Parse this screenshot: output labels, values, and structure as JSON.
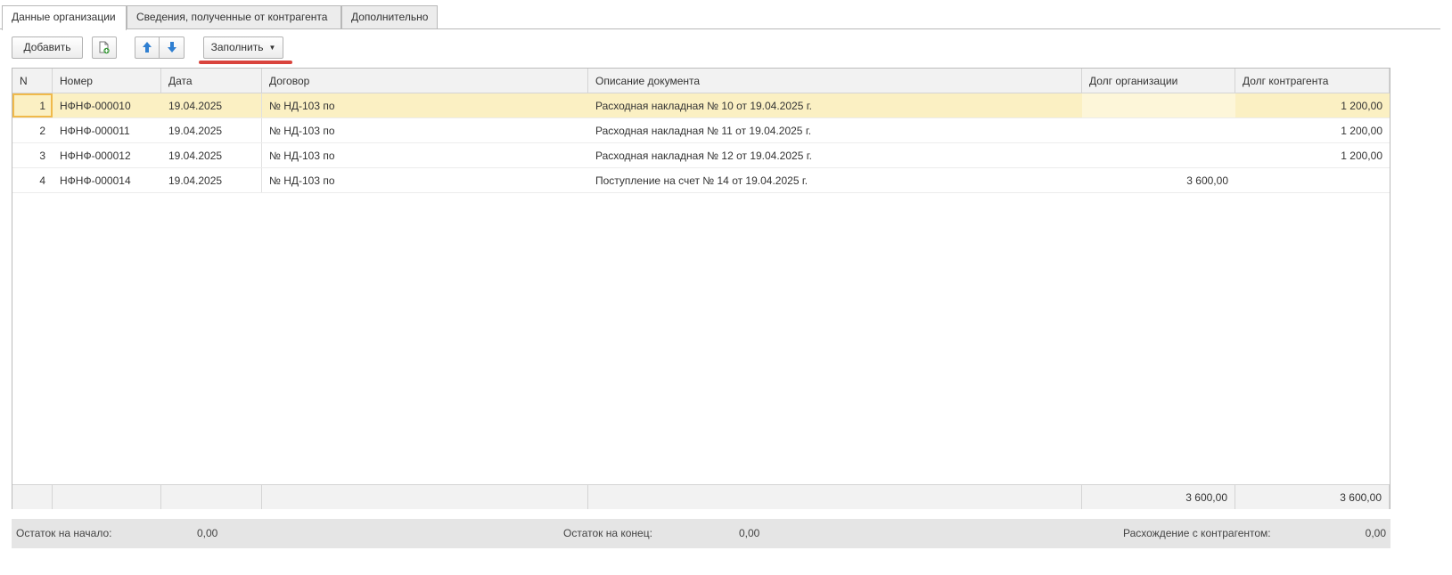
{
  "tabs": [
    {
      "label": "Данные организации",
      "active": true
    },
    {
      "label": "Сведения, полученные от контрагента",
      "active": false
    },
    {
      "label": "Дополнительно",
      "active": false
    }
  ],
  "toolbar": {
    "add_label": "Добавить",
    "fill_label": "Заполнить",
    "copy_icon": "copy-add-icon",
    "up_icon": "arrow-up-icon",
    "down_icon": "arrow-down-icon"
  },
  "table": {
    "columns": [
      "N",
      "Номер",
      "Дата",
      "Договор",
      "Описание документа",
      "Долг организации",
      "Долг контрагента"
    ],
    "rows": [
      {
        "n": "1",
        "number": "НФНФ-000010",
        "date": "19.04.2025",
        "contract": "№ НД-103 по",
        "description": "Расходная накладная № 10 от 19.04.2025 г.",
        "debt_org": "",
        "debt_ctr": "1 200,00",
        "selected": true
      },
      {
        "n": "2",
        "number": "НФНФ-000011",
        "date": "19.04.2025",
        "contract": "№ НД-103 по",
        "description": "Расходная накладная № 11 от 19.04.2025 г.",
        "debt_org": "",
        "debt_ctr": "1 200,00",
        "selected": false
      },
      {
        "n": "3",
        "number": "НФНФ-000012",
        "date": "19.04.2025",
        "contract": "№ НД-103 по",
        "description": "Расходная накладная № 12 от 19.04.2025 г.",
        "debt_org": "",
        "debt_ctr": "1 200,00",
        "selected": false
      },
      {
        "n": "4",
        "number": "НФНФ-000014",
        "date": "19.04.2025",
        "contract": "№ НД-103 по",
        "description": "Поступление на счет № 14 от 19.04.2025 г.",
        "debt_org": "3 600,00",
        "debt_ctr": "",
        "selected": false
      }
    ],
    "totals": {
      "debt_org": "3 600,00",
      "debt_ctr": "3 600,00"
    }
  },
  "summary": {
    "start_label": "Остаток на начало:",
    "start_value": "0,00",
    "end_label": "Остаток на конец:",
    "end_value": "0,00",
    "diff_label": "Расхождение с контрагентом:",
    "diff_value": "0,00"
  },
  "colors": {
    "selected_row": "#fbf0c3",
    "accent_underline": "#d9443d",
    "icon_blue": "#2f7fd1",
    "icon_green": "#3a9a3a"
  }
}
